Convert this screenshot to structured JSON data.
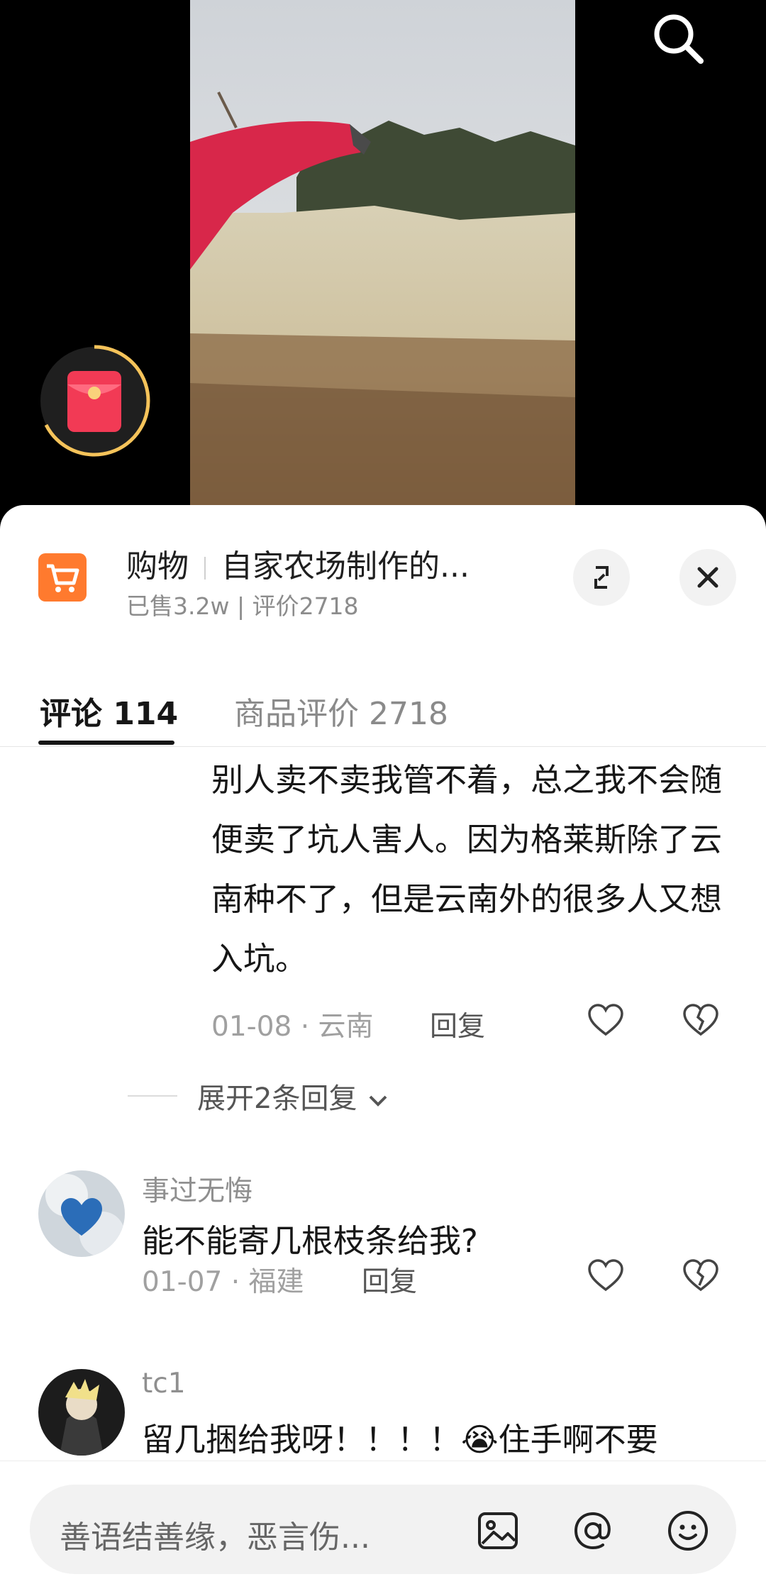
{
  "header": {
    "shop_label": "购物",
    "product_title": "自家农场制作的...",
    "sub": "已售3.2w | 评价2718"
  },
  "tabs": [
    {
      "label": "评论 114",
      "active": true
    },
    {
      "label": "商品评价 2718",
      "active": false
    }
  ],
  "comments": [
    {
      "text": "别人卖不卖我管不着，总之我不会随便卖了坑人害人。因为格莱斯除了云南种不了，但是云南外的很多人又想入坑。",
      "date": "01-08",
      "region": "云南",
      "reply_label": "回复",
      "expand_label": "展开2条回复"
    },
    {
      "user": "事过无悔",
      "text": "能不能寄几根枝条给我?",
      "date": "01-07",
      "region": "福建",
      "reply_label": "回复"
    },
    {
      "user": "tc1",
      "text": "留几捆给我呀！！！！😭住手啊不要",
      "text2": "..."
    }
  ],
  "input": {
    "placeholder": "善语结善缘，恶言伤..."
  },
  "colors": {
    "accent": "#ff7a2e",
    "redpacket": "#f23a55",
    "ring": "#f5c35a"
  },
  "icons": [
    "search-icon",
    "red-packet-icon",
    "cart-icon",
    "expand-icon",
    "close-icon",
    "heart-icon",
    "dislike-icon",
    "image-icon",
    "at-icon",
    "emoji-icon"
  ]
}
